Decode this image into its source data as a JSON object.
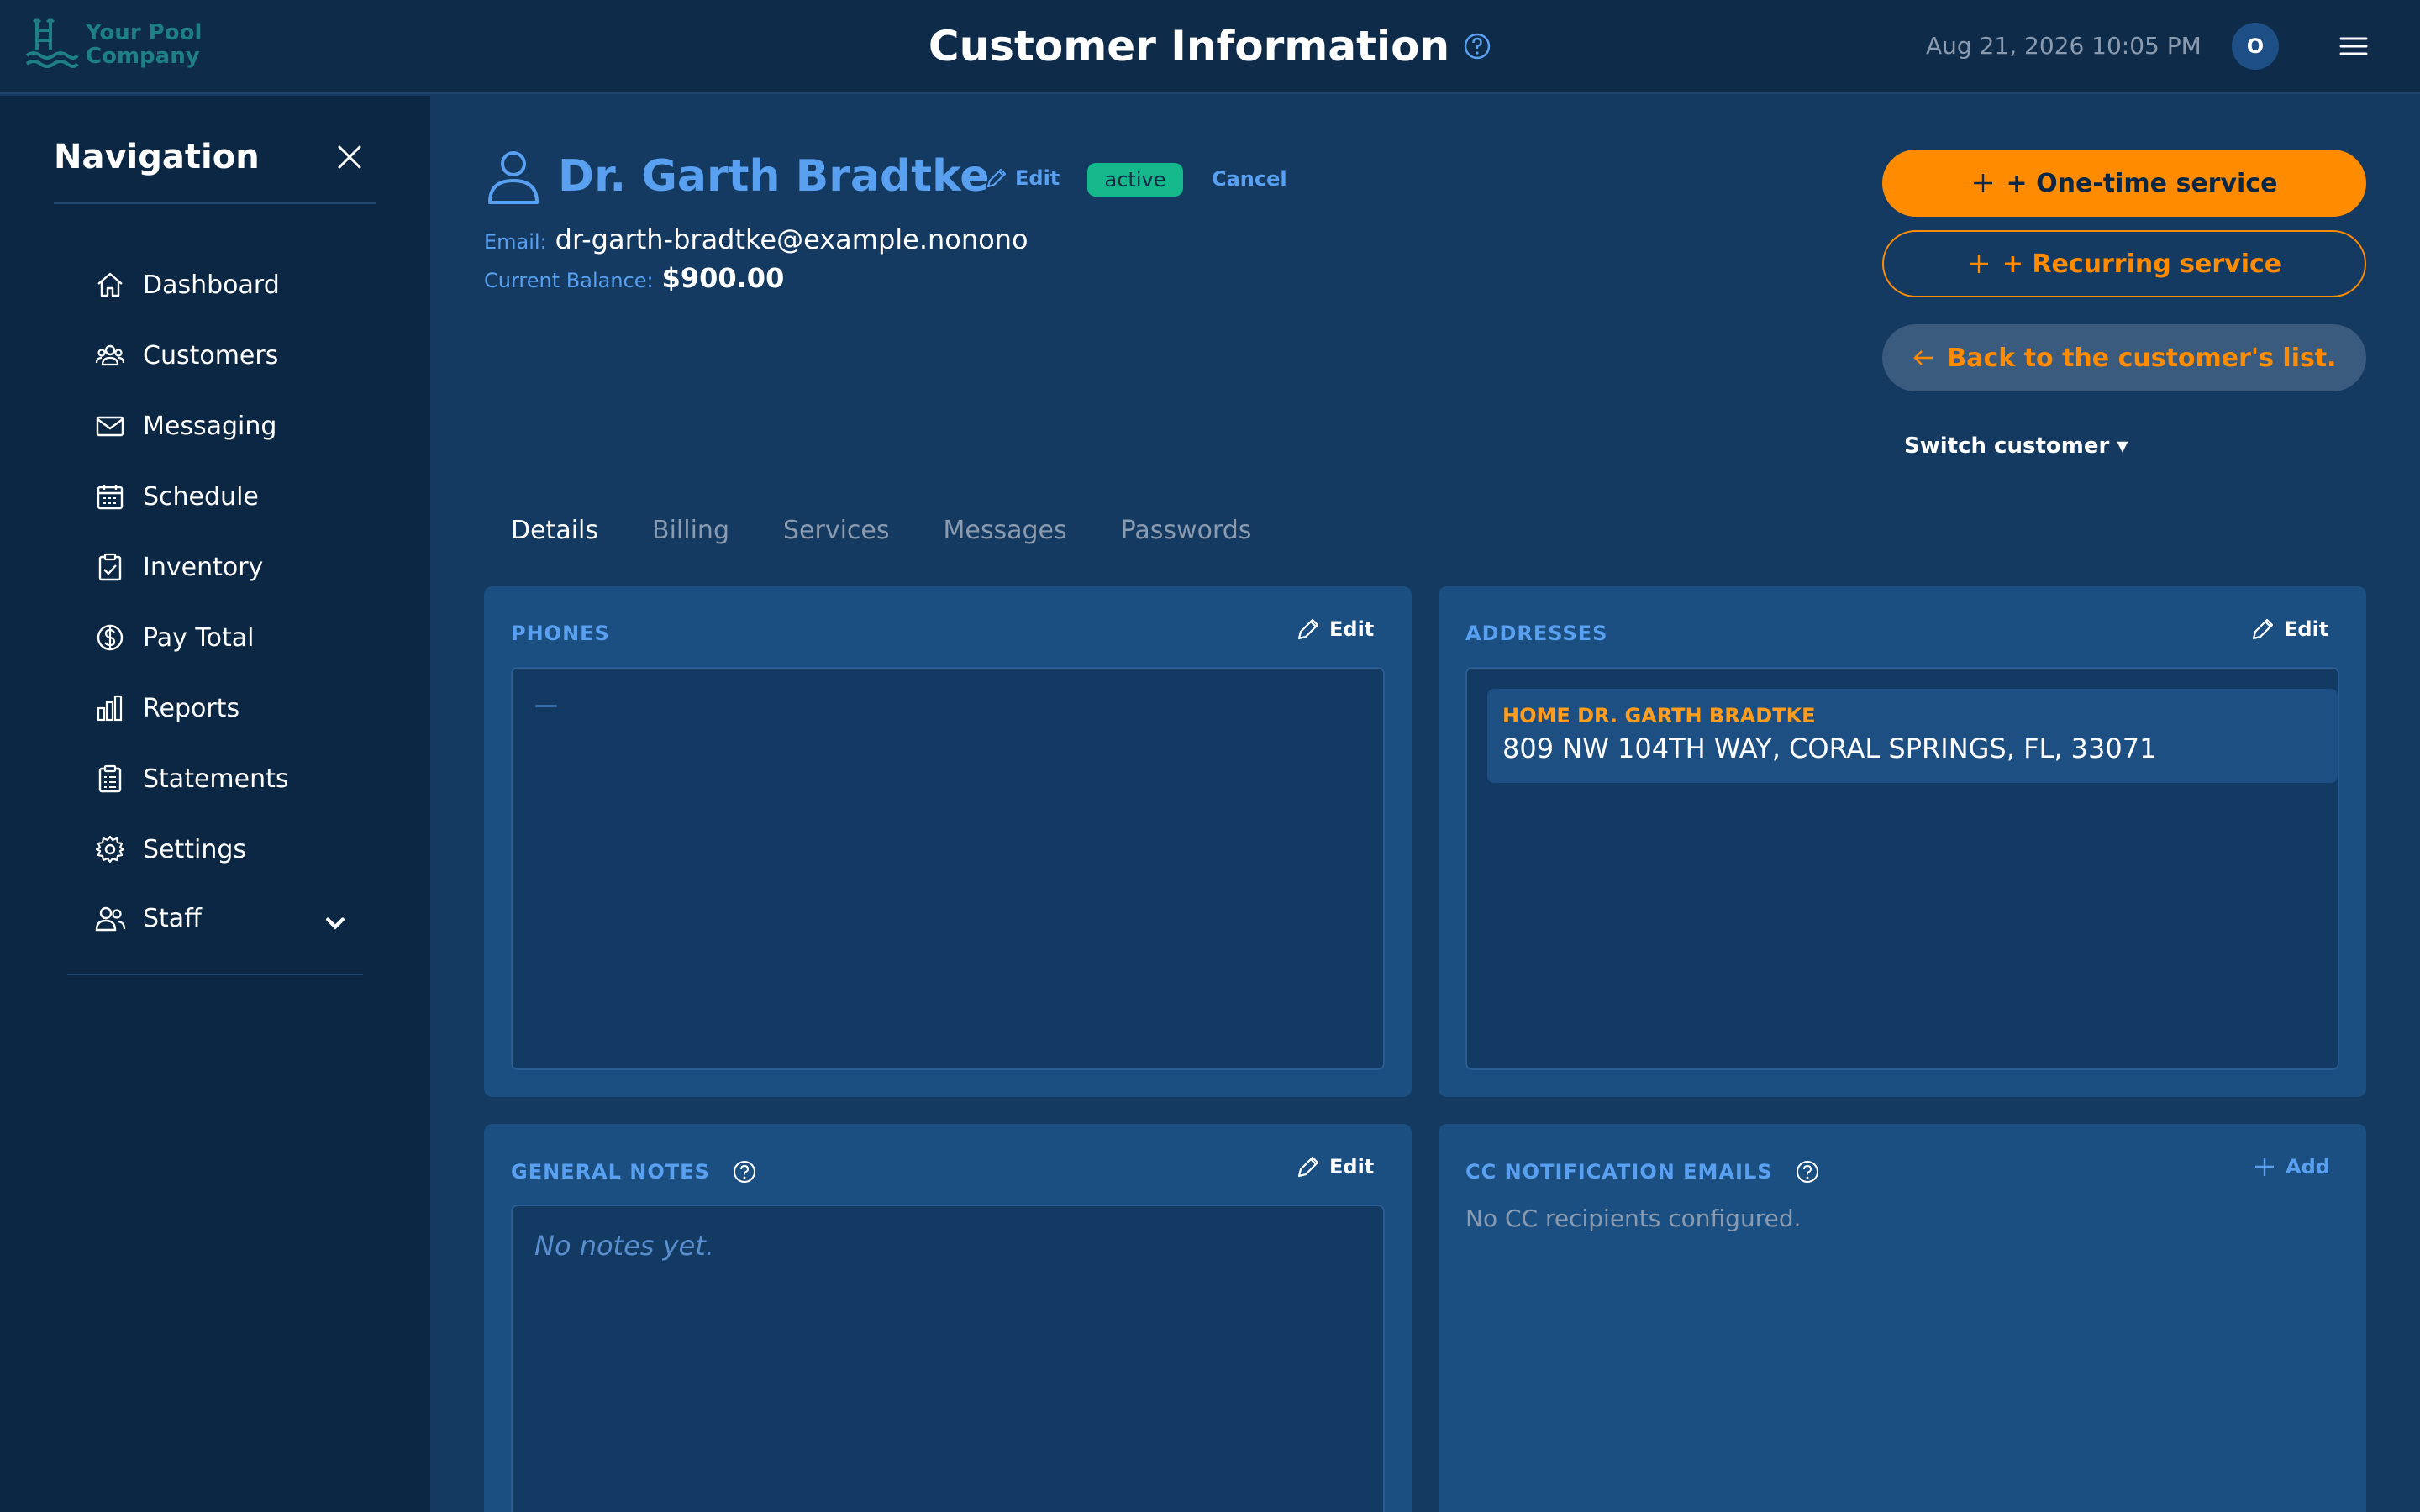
{
  "app": {
    "logo_line1": "Your Pool",
    "logo_line2": "Company",
    "page_title": "Customer Information",
    "datetime": "Aug 21, 2026 10:05 PM",
    "avatar_initial": "O"
  },
  "sidebar": {
    "title": "Navigation",
    "items": [
      {
        "label": "Dashboard",
        "icon": "home-icon"
      },
      {
        "label": "Customers",
        "icon": "users-icon"
      },
      {
        "label": "Messaging",
        "icon": "mail-icon"
      },
      {
        "label": "Schedule",
        "icon": "calendar-icon"
      },
      {
        "label": "Inventory",
        "icon": "clipboard-check-icon"
      },
      {
        "label": "Pay Total",
        "icon": "dollar-circle-icon"
      },
      {
        "label": "Reports",
        "icon": "bar-chart-icon"
      },
      {
        "label": "Statements",
        "icon": "document-list-icon"
      },
      {
        "label": "Settings",
        "icon": "gear-icon"
      },
      {
        "label": "Staff",
        "icon": "staff-icon",
        "expandable": true
      }
    ]
  },
  "customer": {
    "name": "Dr. Garth Bradtke",
    "edit_label": "Edit",
    "status": "active",
    "cancel_label": "Cancel",
    "email_label": "Email:",
    "email": "dr-garth-bradtke@example.nonono",
    "balance_label": "Current Balance:",
    "balance": "$900.00"
  },
  "actions": {
    "one_time": "+ One-time service",
    "recurring": "+ Recurring service",
    "back": "Back to the customer's list.",
    "switch_customer": "Switch customer ▾"
  },
  "tabs": [
    {
      "label": "Details",
      "active": true
    },
    {
      "label": "Billing",
      "active": false
    },
    {
      "label": "Services",
      "active": false
    },
    {
      "label": "Messages",
      "active": false
    },
    {
      "label": "Passwords",
      "active": false
    }
  ],
  "cards": {
    "phones": {
      "title": "PHONES",
      "action": "Edit",
      "empty": "—"
    },
    "addresses": {
      "title": "ADDRESSES",
      "action": "Edit",
      "items": [
        {
          "label": "HOME DR. GARTH BRADTKE",
          "address": "809 NW 104TH WAY, CORAL SPRINGS, FL, 33071"
        }
      ]
    },
    "notes": {
      "title": "GENERAL NOTES",
      "action": "Edit",
      "empty": "No notes yet."
    },
    "cc": {
      "title": "CC NOTIFICATION EMAILS",
      "action": "Add",
      "empty": "No CC recipients configured."
    }
  },
  "colors": {
    "background": "#143a62",
    "topbar": "#0f2b4a",
    "sidebar": "#0c2744",
    "accent_orange": "#ff8c00",
    "accent_blue": "#5aa0f0",
    "status_green": "#14b88a"
  }
}
